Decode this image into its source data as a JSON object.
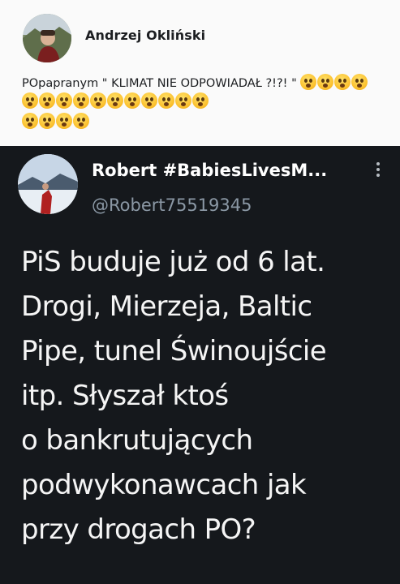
{
  "facebook_post": {
    "author": "Andrzej Okliński",
    "text": "POpapranym \" KLIMAT NIE ODPOWIADAŁ ?!?! \"",
    "emoji_name": "astonished-face-emoji",
    "emoji_count_line1": 15,
    "emoji_count_line2": 4
  },
  "tweet": {
    "display_name": "Robert #BabiesLivesM...",
    "handle": "@Robert75519345",
    "menu_icon": "vertical-ellipsis-icon",
    "body_lines": [
      "PiS buduje już od 6 lat.",
      "Drogi, Mierzeja, Baltic",
      "Pipe, tunel Świnoujście",
      "itp. Słyszał ktoś",
      "o bankrutujących",
      "podwykonawcach jak",
      "przy drogach PO?"
    ]
  },
  "colors": {
    "fb_background": "#fafafa",
    "tweet_background": "#15181c",
    "tweet_text": "#f5f5f5",
    "handle_gray": "#8b98a5"
  }
}
